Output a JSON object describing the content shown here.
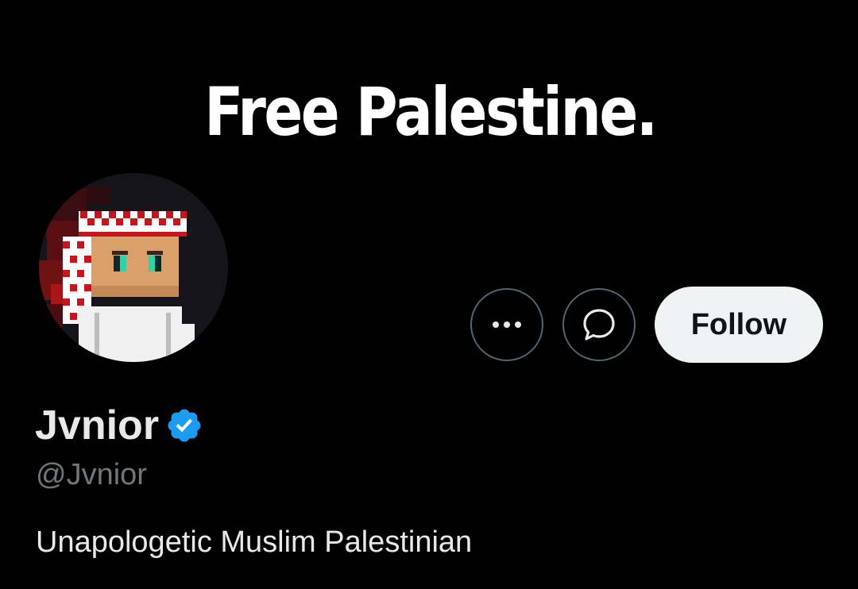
{
  "banner": {
    "text": "Free Palestine."
  },
  "profile": {
    "avatar_icon": "pixel-keffiyeh-avatar",
    "display_name": "Jvnior",
    "verified": true,
    "handle": "@Jvnior",
    "bio": "Unapologetic Muslim Palestinian"
  },
  "actions": {
    "more_icon": "more-dots-icon",
    "message_icon": "message-bubble-icon",
    "follow_label": "Follow"
  },
  "colors": {
    "background": "#000000",
    "text_primary": "#e7e9ea",
    "text_secondary": "#71767b",
    "button_border": "#536471",
    "follow_bg": "#eff3f4",
    "follow_text": "#0f1419",
    "verified_blue": "#1d9bf0"
  }
}
